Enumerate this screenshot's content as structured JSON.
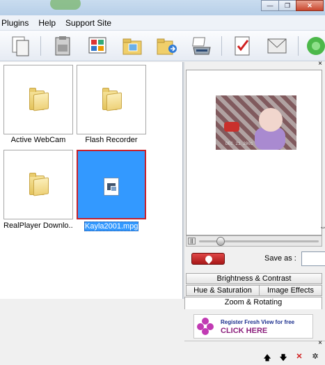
{
  "window": {
    "controls": {
      "minimize": "—",
      "restore": "❐",
      "close": "✕"
    }
  },
  "menu": [
    {
      "label": "Plugins"
    },
    {
      "label": "Help"
    },
    {
      "label": "Support Site"
    }
  ],
  "toolbar": {
    "icons": [
      "copy-pages-icon",
      "clipboard-icon",
      "slideshow-icon",
      "folder-images-icon",
      "folder-share-icon",
      "scanner-icon",
      "checklist-icon",
      "email-icon",
      "green-plugin-icon"
    ]
  },
  "thumbnails": [
    {
      "caption": "Active WebCam",
      "kind": "folder",
      "selected": false
    },
    {
      "caption": "Flash Recorder",
      "kind": "folder",
      "selected": false
    },
    {
      "caption": "RealPlayer Downlo...",
      "kind": "folder",
      "selected": false
    },
    {
      "caption": "Kayla2001.mpg",
      "kind": "video-file",
      "selected": true
    }
  ],
  "preview": {
    "timestamp": "DEC 21 2001",
    "pause_label": "||",
    "playback_progress": 0.18
  },
  "save": {
    "label": "Save as :",
    "value": ""
  },
  "tabs": {
    "brightness": "Brightness & Contrast",
    "hue": "Hue & Saturation",
    "effects": "Image Effects",
    "zoom": "Zoom & Rotating"
  },
  "ad": {
    "line1": "Register Fresh View for free",
    "line2": "CLICK HERE"
  },
  "panel_close": "×",
  "bottom_controls": {
    "up": "🡅",
    "down": "🡇",
    "delete": "✕",
    "more": "✲"
  },
  "colors": {
    "selection": "#3399ff",
    "selection_border": "#c8202a",
    "accent_red": "#d01f1f"
  }
}
